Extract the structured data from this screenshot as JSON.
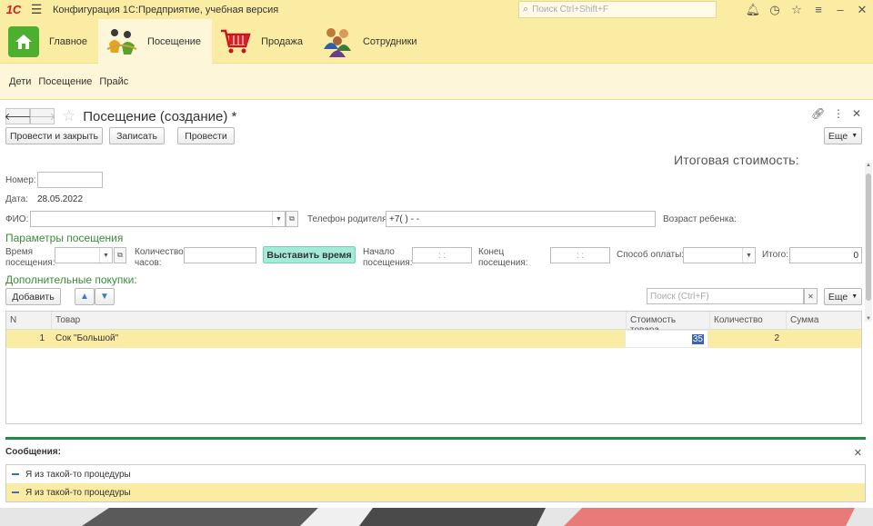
{
  "titlebar": {
    "logo": "1С",
    "app_title": "Конфигурация 1С:Предприятие, учебная версия",
    "search_placeholder": "Поиск Ctrl+Shift+F",
    "icons": [
      "bell-icon",
      "history-icon",
      "star-icon",
      "menu-icon",
      "minimize-icon",
      "close-icon"
    ]
  },
  "sections": [
    {
      "label": "Главное",
      "icon": "home-icon",
      "active": false
    },
    {
      "label": "Посещение",
      "icon": "visit-icon",
      "active": true
    },
    {
      "label": "Продажа",
      "icon": "cart-icon",
      "active": false
    },
    {
      "label": "Сотрудники",
      "icon": "employees-icon",
      "active": false
    }
  ],
  "nav": [
    "Дети",
    "Посещение",
    "Прайс"
  ],
  "form": {
    "title": "Посещение (создание) *",
    "buttons": {
      "post_close": "Провести и закрыть",
      "save": "Записать",
      "post": "Провести",
      "more": "Еще"
    },
    "total_caption": "Итоговая стоимость:",
    "number_label": "Номер:",
    "number_value": "",
    "date_label": "Дата:",
    "date_value": "28.05.2022",
    "fio_label": "ФИО:",
    "fio_value": "",
    "phone_label": "Телефон родителя:",
    "phone_value": "+7(   )   -  -",
    "age_label": "Возраст ребенка:",
    "params_title": "Параметры посещения",
    "time_label": "Время посещения:",
    "hours_label": "Количество часов:",
    "set_time_button": "Выставить время",
    "start_label": "Начало посещения:",
    "start_value": ":  :",
    "end_label": "Конец посещения:",
    "end_value": ":  :",
    "payment_label": "Способ оплаты:",
    "total_label": "Итого:",
    "total_value": "0",
    "extra_title": "Дополнительные покупки:",
    "add_button": "Добавить",
    "table_search_placeholder": "Поиск (Ctrl+F)",
    "table_more": "Еще"
  },
  "table": {
    "columns": [
      "N",
      "Товар",
      "Стоимость товара",
      "Количество",
      "Сумма"
    ],
    "rows": [
      {
        "n": "1",
        "product": "Сок \"Большой\"",
        "price": "35",
        "qty": "2",
        "sum": ""
      }
    ]
  },
  "messages": {
    "title": "Сообщения:",
    "items": [
      "Я из такой-то процедуры",
      "Я из такой-то процедуры"
    ]
  },
  "colors": {
    "accent_yellow": "#fbeca4",
    "group_green": "#3c8a3c",
    "button_green": "#a3ebd9",
    "selection_blue": "#3a63b8"
  }
}
